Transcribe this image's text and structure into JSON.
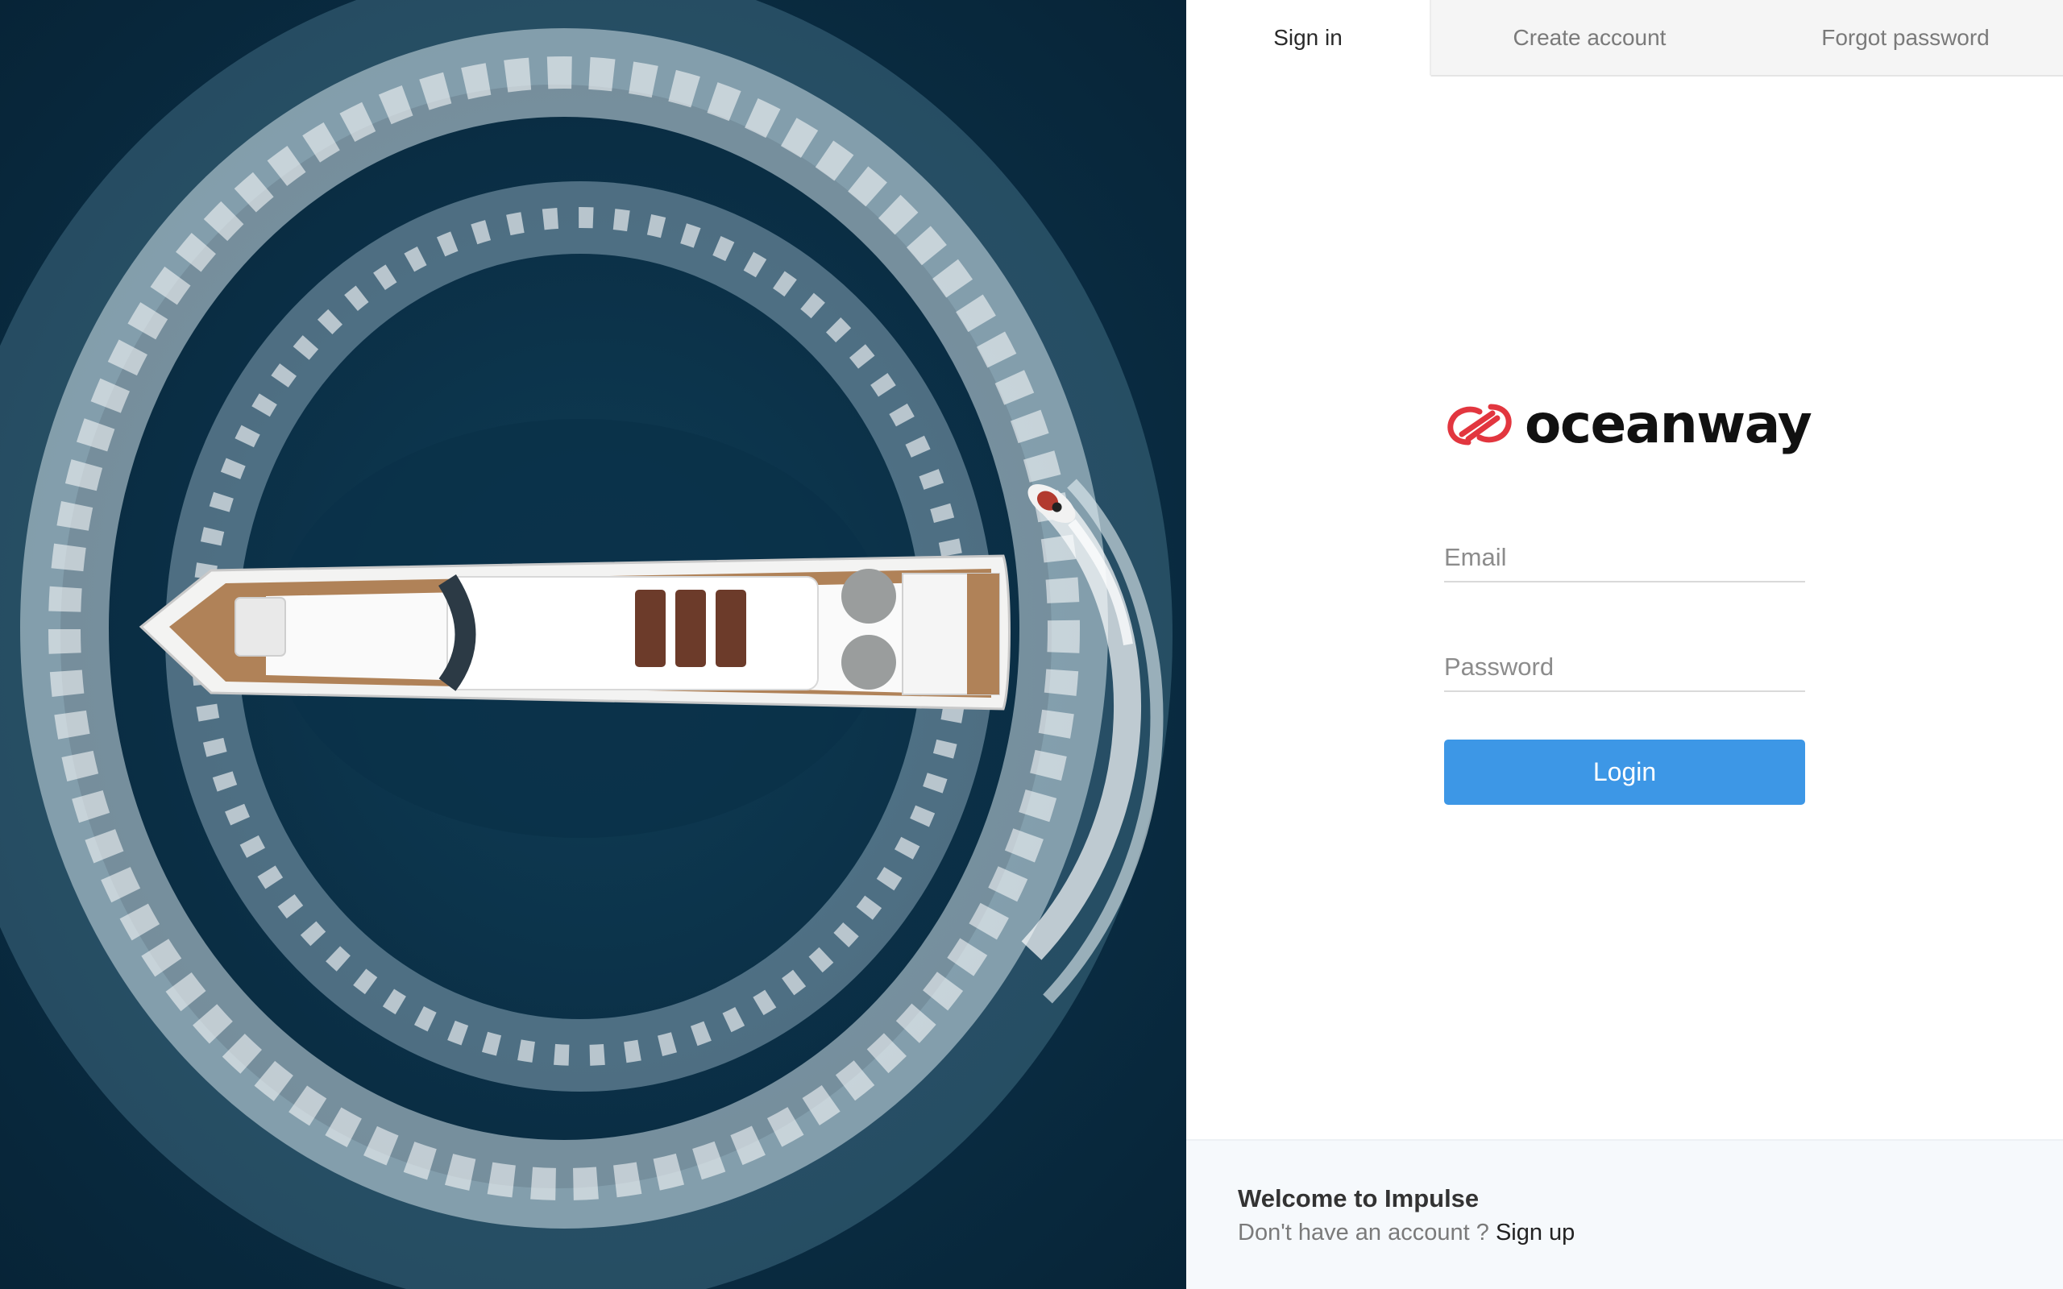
{
  "tabs": [
    {
      "label": "Sign in",
      "active": true
    },
    {
      "label": "Create account",
      "active": false
    },
    {
      "label": "Forgot password",
      "active": false
    }
  ],
  "brand": {
    "name": "oceanway",
    "mark_icon": "interlocking-rings-logo-icon",
    "mark_color": "#e2363f"
  },
  "form": {
    "email_placeholder": "Email",
    "email_value": "",
    "password_placeholder": "Password",
    "password_value": "",
    "login_label": "Login",
    "accent_color": "#3d97e6"
  },
  "footer": {
    "title": "Welcome to Impulse",
    "prompt": "Don't have an account ?",
    "link_label": "Sign up"
  },
  "hero": {
    "image_subject": "aerial-yacht-wake-photo"
  }
}
